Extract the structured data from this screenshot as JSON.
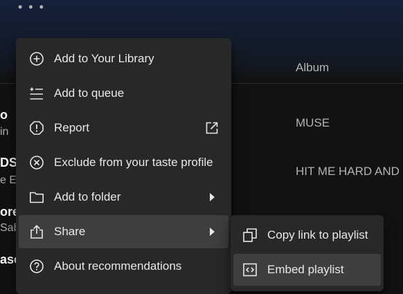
{
  "background": {
    "more_dots": "• • •",
    "column_album": "Album",
    "rows": [
      {
        "title_fragment": "o",
        "subtitle_fragment": "in",
        "album": "MUSE"
      },
      {
        "title_fragment": "DS",
        "subtitle_fragment": "e Ei",
        "album": "HIT ME HARD AND S"
      },
      {
        "title_fragment": "ore",
        "subtitle_fragment": "Sab",
        "album": ""
      },
      {
        "title_fragment": "ase",
        "subtitle_fragment": "",
        "album": ""
      }
    ]
  },
  "context_menu": {
    "items": [
      {
        "label": "Add to Your Library",
        "icon": "plus-circle-icon"
      },
      {
        "label": "Add to queue",
        "icon": "add-to-queue-icon"
      },
      {
        "label": "Report",
        "icon": "exclamation-circle-icon",
        "trailing_icon": "external-link-icon"
      },
      {
        "label": "Exclude from your taste profile",
        "icon": "x-circle-icon"
      },
      {
        "label": "Add to folder",
        "icon": "folder-icon",
        "trailing_icon": "chevron-right-icon"
      },
      {
        "label": "Share",
        "icon": "share-icon",
        "trailing_icon": "chevron-right-icon",
        "state": "hovered"
      },
      {
        "label": "About recommendations",
        "icon": "question-circle-icon"
      }
    ]
  },
  "share_submenu": {
    "items": [
      {
        "label": "Copy link to playlist",
        "icon": "copy-icon"
      },
      {
        "label": "Embed playlist",
        "icon": "embed-icon",
        "state": "hovered"
      }
    ]
  },
  "colors": {
    "menu_bg": "#282828",
    "hover_bg": "#3e3e3e",
    "page_bg": "#121212",
    "text_primary": "#e8e8e8",
    "text_secondary": "#b3b3b3"
  }
}
